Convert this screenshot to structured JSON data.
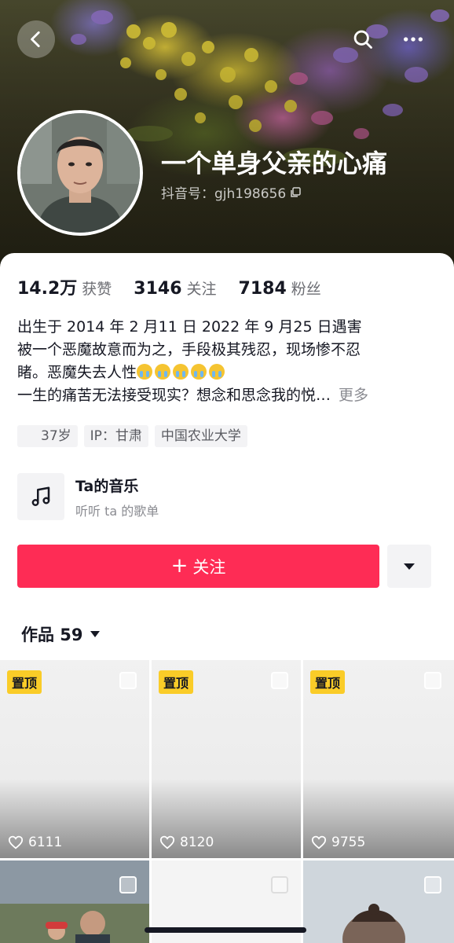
{
  "header": {
    "back_icon": "chevron-left-icon",
    "search_icon": "search-icon",
    "more_icon": "more-dots-icon"
  },
  "profile": {
    "name": "一个单身父亲的心痛",
    "douyin_id": "抖音号：gjh198656",
    "copy_icon": "copy-icon"
  },
  "stats": [
    {
      "value": "14.2万",
      "label": "获赞"
    },
    {
      "value": "3146",
      "label": "关注"
    },
    {
      "value": "7184",
      "label": "粉丝"
    }
  ],
  "bio": {
    "line1": "出生于 2014 年 2 月11 日  2022 年 9 月25 日遇害",
    "line2": "被一个恶魔故意而为之，手段极其残忍，现场惨不忍",
    "line3": "睹。恶魔失去人性",
    "line3_emoji_count": 5,
    "line4": "一生的痛苦无法接受现实？想念和思念我的悦…",
    "more": "更多"
  },
  "tags": [
    "37岁",
    "IP：甘肃",
    "中国农业大学"
  ],
  "music": {
    "icon": "music-note-icon",
    "title": "Ta的音乐",
    "subtitle": "听听 ta 的歌单"
  },
  "actions": {
    "follow_label": "关注",
    "dropdown_icon": "caret-down-icon"
  },
  "works_tab": {
    "label": "作品 59"
  },
  "videos": [
    {
      "pinned_label": "置顶",
      "likes": "6111"
    },
    {
      "pinned_label": "置顶",
      "likes": "8120"
    },
    {
      "pinned_label": "置顶",
      "likes": "9755"
    }
  ],
  "colors": {
    "accent": "#fe2c55",
    "pin_badge": "#facc28",
    "text_primary": "#161823",
    "text_secondary": "#6b6c72"
  }
}
